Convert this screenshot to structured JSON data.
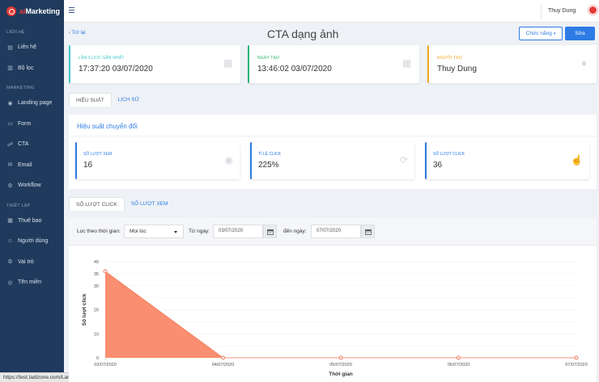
{
  "brand": {
    "prefix": "ai",
    "name": "Marketing"
  },
  "sidebar": {
    "sections": [
      {
        "title": "LIÊN HỆ",
        "items": [
          {
            "label": "Liên hệ",
            "icon": "contact-book-icon"
          },
          {
            "label": "Bộ lọc",
            "icon": "filter-icon"
          }
        ]
      },
      {
        "title": "MARKETING",
        "items": [
          {
            "label": "Landing page",
            "icon": "landing-page-icon"
          },
          {
            "label": "Form",
            "icon": "form-icon"
          },
          {
            "label": "CTA",
            "icon": "cta-icon"
          },
          {
            "label": "Email",
            "icon": "email-icon"
          },
          {
            "label": "Workflow",
            "icon": "workflow-icon"
          }
        ]
      },
      {
        "title": "THIẾT LẬP",
        "items": [
          {
            "label": "Thuê bao",
            "icon": "subscription-icon"
          },
          {
            "label": "Người dùng",
            "icon": "users-icon"
          },
          {
            "label": "Vai trò",
            "icon": "roles-icon"
          },
          {
            "label": "Tên miền",
            "icon": "domain-icon"
          }
        ]
      }
    ]
  },
  "topbar": {
    "username": "Thuy Dung"
  },
  "header": {
    "back": "‹ Trở lại",
    "title": "CTA dạng ảnh",
    "func_button": "Chức năng",
    "edit_button": "Sửa"
  },
  "info_cards": [
    {
      "label": "LẦN CLICK GẦN NHẤT",
      "value": "17:37:20 03/07/2020",
      "color": "#3ec6c9",
      "icon": "calendar-icon"
    },
    {
      "label": "NGÀY TẠO",
      "value": "13:46:02 03/07/2020",
      "color": "#2bb673",
      "icon": "calendar-icon"
    },
    {
      "label": "NGƯỜI TẠO",
      "value": "Thuy Dung",
      "color": "#f5a623",
      "icon": "user-icon"
    }
  ],
  "tabs_main": [
    {
      "label": "HIỆU SUẤT",
      "active": true
    },
    {
      "label": "LỊCH SỬ",
      "active": false
    }
  ],
  "performance": {
    "title": "Hiệu suất chuyển đổi",
    "stats": [
      {
        "label": "SỐ LƯỢT XEM",
        "value": "16",
        "icon": "eye-icon"
      },
      {
        "label": "TỈ LỆ CLICK",
        "value": "225%",
        "icon": "refresh-icon"
      },
      {
        "label": "SỐ LƯỢT CLICK",
        "value": "36",
        "icon": "pointer-hand-icon"
      }
    ]
  },
  "tabs_chart": [
    {
      "label": "SỐ LƯỢT CLICK",
      "active": true
    },
    {
      "label": "SỐ LƯỢT XEM",
      "active": false
    }
  ],
  "filter": {
    "period_label": "Lọc theo thời gian:",
    "period_value": "Mọi lúc",
    "from_label": "Từ ngày:",
    "from_value": "03/07/2020",
    "to_label": "đến ngày:",
    "to_value": "07/07/2020"
  },
  "status_url": "https://test.ladizone.com/LandingPage",
  "chart_data": {
    "type": "area",
    "x": [
      "03/07/2020",
      "04/07/2020",
      "05/07/2020",
      "06/07/2020",
      "07/07/2020"
    ],
    "values": [
      36,
      0,
      0,
      0,
      0
    ],
    "xlabel": "Thời gian",
    "ylabel": "Số lượt click",
    "ylim": [
      0,
      40
    ],
    "yticks": [
      0,
      5,
      10,
      15,
      20,
      25,
      30,
      35,
      40
    ],
    "grid": true,
    "fill_color": "#fa8e70",
    "line_color": "#f07a5a"
  }
}
